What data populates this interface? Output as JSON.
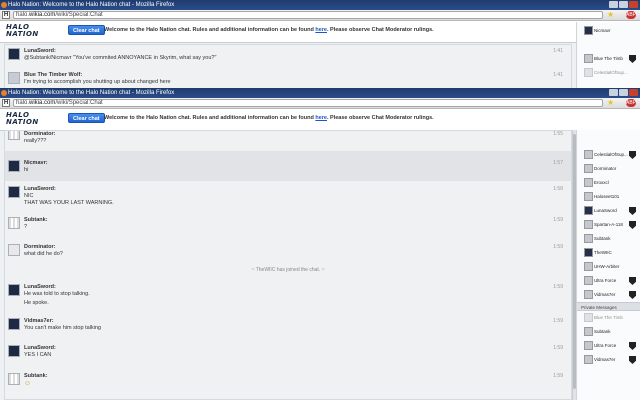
{
  "window_title": "Halo Nation: Welcome to the Halo Nation chat - Mozilla Firefox",
  "url_prefix": "halo.",
  "url_host": "wikia.com",
  "url_path": "/wiki/Special:Chat",
  "logo_line1": "HALO",
  "logo_line2": "NATION",
  "clear_chat_label": "Clear chat",
  "welcome": {
    "before": "Welcome to the Halo Nation chat. Rules and additional information can be found ",
    "link": "here",
    "after": ". Please observe Chat Moderator rulings."
  },
  "back_window": {
    "messages": [
      {
        "name": "LunaSword:",
        "text": "@Subtank/Nicmavr \"You've commited ANNOYANCE in Skyrim, what say you?\"",
        "time": "1:41"
      },
      {
        "name": "Blue The Timber Wolf:",
        "text": "I'm trying to accomplish you shutting up about changed here",
        "time": "1:41"
      }
    ],
    "users": [
      "Nicmavr",
      "Blue The Timb",
      "CelestialOfSup..."
    ]
  },
  "front_window": {
    "messages": [
      {
        "name": "Dorminator:",
        "lines": [
          "really???"
        ],
        "time": "1:55"
      },
      {
        "name": "Nicmavr:",
        "lines": [
          "hi"
        ],
        "time": "1:57"
      },
      {
        "name": "LunaSword:",
        "lines": [
          "NIC",
          "THAT WAS YOUR LAST WARNING."
        ],
        "time": "1:58"
      },
      {
        "name": "Subtank:",
        "lines": [
          "?"
        ],
        "time": "1:59"
      },
      {
        "name": "Dorminator:",
        "lines": [
          "what did he do?"
        ],
        "time": "1:59"
      },
      {
        "name": "LunaSword:",
        "lines": [
          "He was told to stop talking.",
          "He spoke."
        ],
        "time": "1:59"
      },
      {
        "name": "Vidmas7er:",
        "lines": [
          "You can't make him stop talking"
        ],
        "time": "1:59"
      },
      {
        "name": "LunaSword:",
        "lines": [
          "YES I CAN"
        ],
        "time": "1:59"
      },
      {
        "name": "Subtank:",
        "lines": [
          "☺"
        ],
        "time": "1:59"
      }
    ],
    "inline_alert": "~ TheWIIC has joined the chat. ~",
    "users": [
      "CelestialOfSup...",
      "Dorminator",
      "Eroxxcl",
      "Haloseet101",
      "LunaSword",
      "Spartan-A-118",
      "Subtank",
      "TheWIIC",
      "UHW-Arbiter",
      "Ultra Force",
      "Vidmas7er"
    ],
    "private_header": "Private Messages",
    "private_users": [
      "Blue The Timb",
      "Subtank",
      "Ultra Force",
      "Vidmas7er"
    ]
  },
  "colors": {
    "titlebar": "#1f3b6e",
    "button": "#1f66d0",
    "link": "#1f55c8"
  }
}
